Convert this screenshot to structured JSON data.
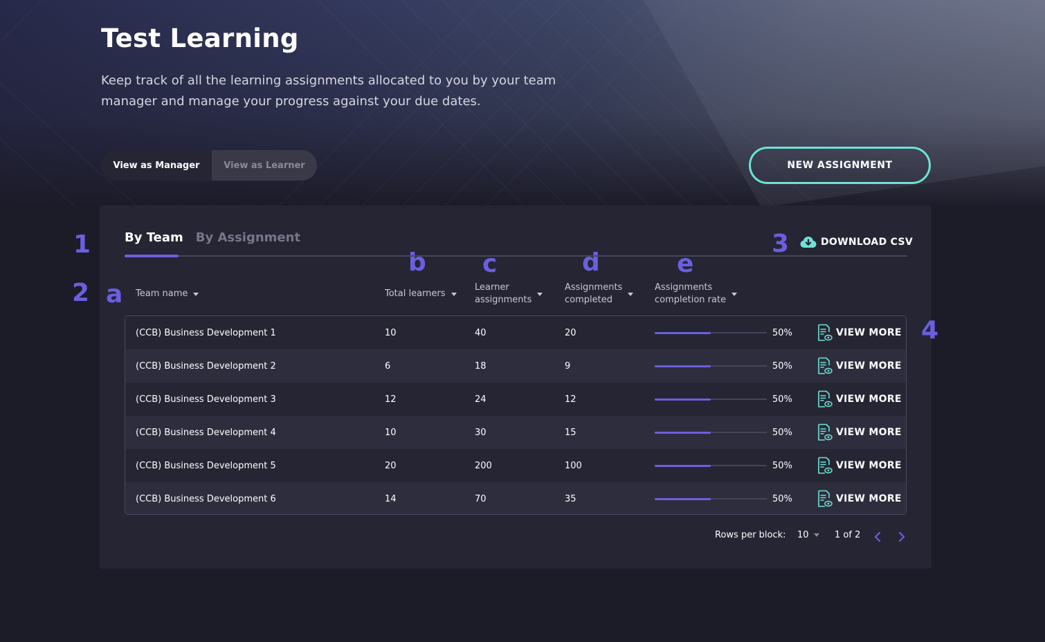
{
  "header": {
    "title": "Test Learning",
    "subtitle": "Keep track of all the learning assignments allocated to you by your team manager and manage your progress against your due dates."
  },
  "view_toggle": {
    "options": [
      "View as Manager",
      "View as Learner"
    ],
    "selected": "View as Manager"
  },
  "new_assignment_label": "NEW ASSIGNMENT",
  "tabs": [
    "By Team",
    "By Assignment"
  ],
  "active_tab": "By Team",
  "download_csv_label": "DOWNLOAD CSV",
  "annotations": {
    "m1": "1",
    "m2": "2",
    "m3": "3",
    "m4": "4",
    "a": "a",
    "b": "b",
    "c": "c",
    "d": "d",
    "e": "e"
  },
  "table": {
    "columns": [
      "Team name",
      "Total learners",
      "Learner assignments",
      "Assignments completed",
      "Assignments completion rate"
    ],
    "columns_wrapped": {
      "c1": "Learner",
      "c2": "assignments",
      "d1": "Assignments",
      "d2": "completed",
      "e1": "Assignments",
      "e2": "completion rate"
    },
    "view_more_label": "VIEW MORE",
    "rows": [
      {
        "team": "(CCB) Business Development 1",
        "learners": "10",
        "assignments": "40",
        "completed": "20",
        "rate": "50%",
        "rate_value": 0.5
      },
      {
        "team": "(CCB) Business Development 2",
        "learners": "6",
        "assignments": "18",
        "completed": "9",
        "rate": "50%",
        "rate_value": 0.5
      },
      {
        "team": "(CCB) Business Development 3",
        "learners": "12",
        "assignments": "24",
        "completed": "12",
        "rate": "50%",
        "rate_value": 0.5
      },
      {
        "team": "(CCB) Business Development 4",
        "learners": "10",
        "assignments": "30",
        "completed": "15",
        "rate": "50%",
        "rate_value": 0.5
      },
      {
        "team": "(CCB) Business Development 5",
        "learners": "20",
        "assignments": "200",
        "completed": "100",
        "rate": "50%",
        "rate_value": 0.5
      },
      {
        "team": "(CCB) Business Development 6",
        "learners": "14",
        "assignments": "70",
        "completed": "35",
        "rate": "50%",
        "rate_value": 0.5
      }
    ]
  },
  "pagination": {
    "rows_per_block_label": "Rows per block:",
    "rows_per_block_value": "10",
    "page_label": "1 of 2"
  },
  "colors": {
    "accent": "#6b5fe0",
    "teal": "#6de3d5",
    "background": "#1c1b28",
    "panel": "#262534"
  }
}
